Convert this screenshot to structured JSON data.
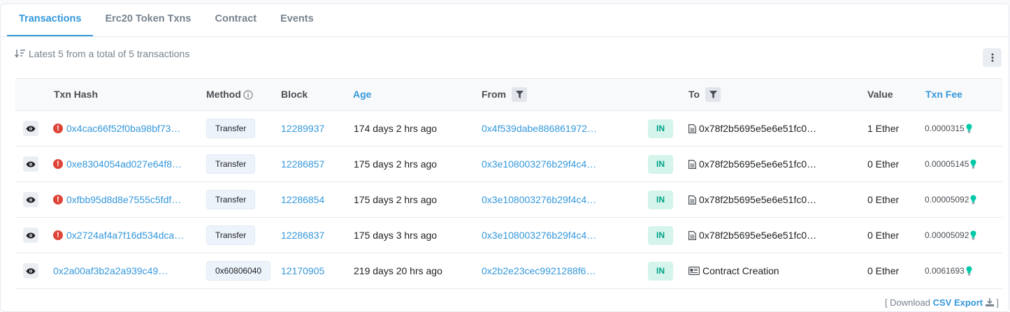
{
  "tabs": [
    {
      "label": "Transactions"
    },
    {
      "label": "Erc20 Token Txns"
    },
    {
      "label": "Contract"
    },
    {
      "label": "Events"
    }
  ],
  "summary": "Latest 5 from a total of 5 transactions",
  "columns": {
    "txn_hash": "Txn Hash",
    "method": "Method",
    "block": "Block",
    "age": "Age",
    "from": "From",
    "to": "To",
    "value": "Value",
    "txn_fee": "Txn Fee"
  },
  "rows": [
    {
      "hash": "0x4cac66f52f0ba98bf73…",
      "error": true,
      "method": "Transfer",
      "block": "12289937",
      "age": "174 days 2 hrs ago",
      "from": "0x4f539dabe886861972…",
      "direction": "IN",
      "to": "0x78f2b5695e5e6e51fc0…",
      "to_icon": "document-icon",
      "value": "1 Ether",
      "fee": "0.0000315"
    },
    {
      "hash": "0xe8304054ad027e64f8…",
      "error": true,
      "method": "Transfer",
      "block": "12286857",
      "age": "175 days 2 hrs ago",
      "from": "0x3e108003276b29f4c4…",
      "direction": "IN",
      "to": "0x78f2b5695e5e6e51fc0…",
      "to_icon": "document-icon",
      "value": "0 Ether",
      "fee": "0.00005145"
    },
    {
      "hash": "0xfbb95d8d8e7555c5fdf…",
      "error": true,
      "method": "Transfer",
      "block": "12286854",
      "age": "175 days 2 hrs ago",
      "from": "0x3e108003276b29f4c4…",
      "direction": "IN",
      "to": "0x78f2b5695e5e6e51fc0…",
      "to_icon": "document-icon",
      "value": "0 Ether",
      "fee": "0.00005092"
    },
    {
      "hash": "0x2724af4a7f16d534dca…",
      "error": true,
      "method": "Transfer",
      "block": "12286837",
      "age": "175 days 3 hrs ago",
      "from": "0x3e108003276b29f4c4…",
      "direction": "IN",
      "to": "0x78f2b5695e5e6e51fc0…",
      "to_icon": "document-icon",
      "value": "0 Ether",
      "fee": "0.00005092"
    },
    {
      "hash": "0x2a00af3b2a2a939c49…",
      "error": false,
      "method": "0x60806040",
      "block": "12170905",
      "age": "219 days 20 hrs ago",
      "from": "0x2b2e23cec9921288f6…",
      "direction": "IN",
      "to": "Contract Creation",
      "to_icon": "contract-creation-icon",
      "value": "0 Ether",
      "fee": "0.0061693"
    }
  ],
  "footer": {
    "open": "[ Download",
    "csv_label": "CSV Export",
    "close": "]"
  },
  "colors": {
    "accent": "#3498db",
    "error": "#de4437",
    "in_badge": "#00a186",
    "bulb": "#00c9a7"
  }
}
